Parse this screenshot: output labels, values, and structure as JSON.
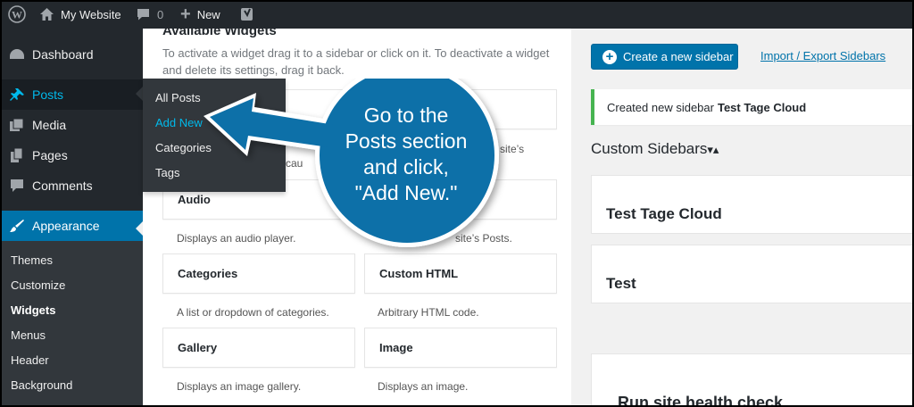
{
  "admin_bar": {
    "site_name": "My Website",
    "comments_count": "0",
    "new_label": "New"
  },
  "sidebar": {
    "items": [
      {
        "label": "Dashboard"
      },
      {
        "label": "Posts"
      },
      {
        "label": "Media"
      },
      {
        "label": "Pages"
      },
      {
        "label": "Comments"
      },
      {
        "label": "Appearance"
      }
    ],
    "appearance_submenu": [
      "Themes",
      "Customize",
      "Widgets",
      "Menus",
      "Header",
      "Background"
    ]
  },
  "posts_flyout": [
    "All Posts",
    "Add New",
    "Categories",
    "Tags"
  ],
  "available_widgets": {
    "heading": "Available Widgets",
    "description": "To activate a widget drag it to a sidebar or click on it. To deactivate a widget and delete its settings, drag it back.",
    "partial_desc_left": "cau",
    "partial_desc_right": "site’s",
    "partial_desc_right2": "site’s Posts.",
    "widgets": [
      {
        "title": "Audio",
        "desc": "Displays an audio player."
      },
      {
        "title": "Categories",
        "desc": "A list or dropdown of categories."
      },
      {
        "title": "Custom HTML",
        "desc": "Arbitrary HTML code."
      },
      {
        "title": "Gallery",
        "desc": "Displays an image gallery."
      },
      {
        "title": "Image",
        "desc": "Displays an image."
      }
    ]
  },
  "right_panel": {
    "create_button": "Create a new sidebar",
    "import_link": "Import / Export Sidebars",
    "notice_prefix": "Created new sidebar",
    "notice_name": "Test Tage Cloud",
    "custom_sidebars_heading": "Custom Sidebars",
    "sort_indicator": "▾▴",
    "sidebars": [
      "Test Tage Cloud",
      "Test"
    ],
    "health_check": "Run site health check"
  },
  "callout": {
    "lines": [
      "Go to the",
      "Posts section",
      "and click,",
      "\"Add New.\""
    ],
    "bubble_color": "#0d6fa8"
  }
}
